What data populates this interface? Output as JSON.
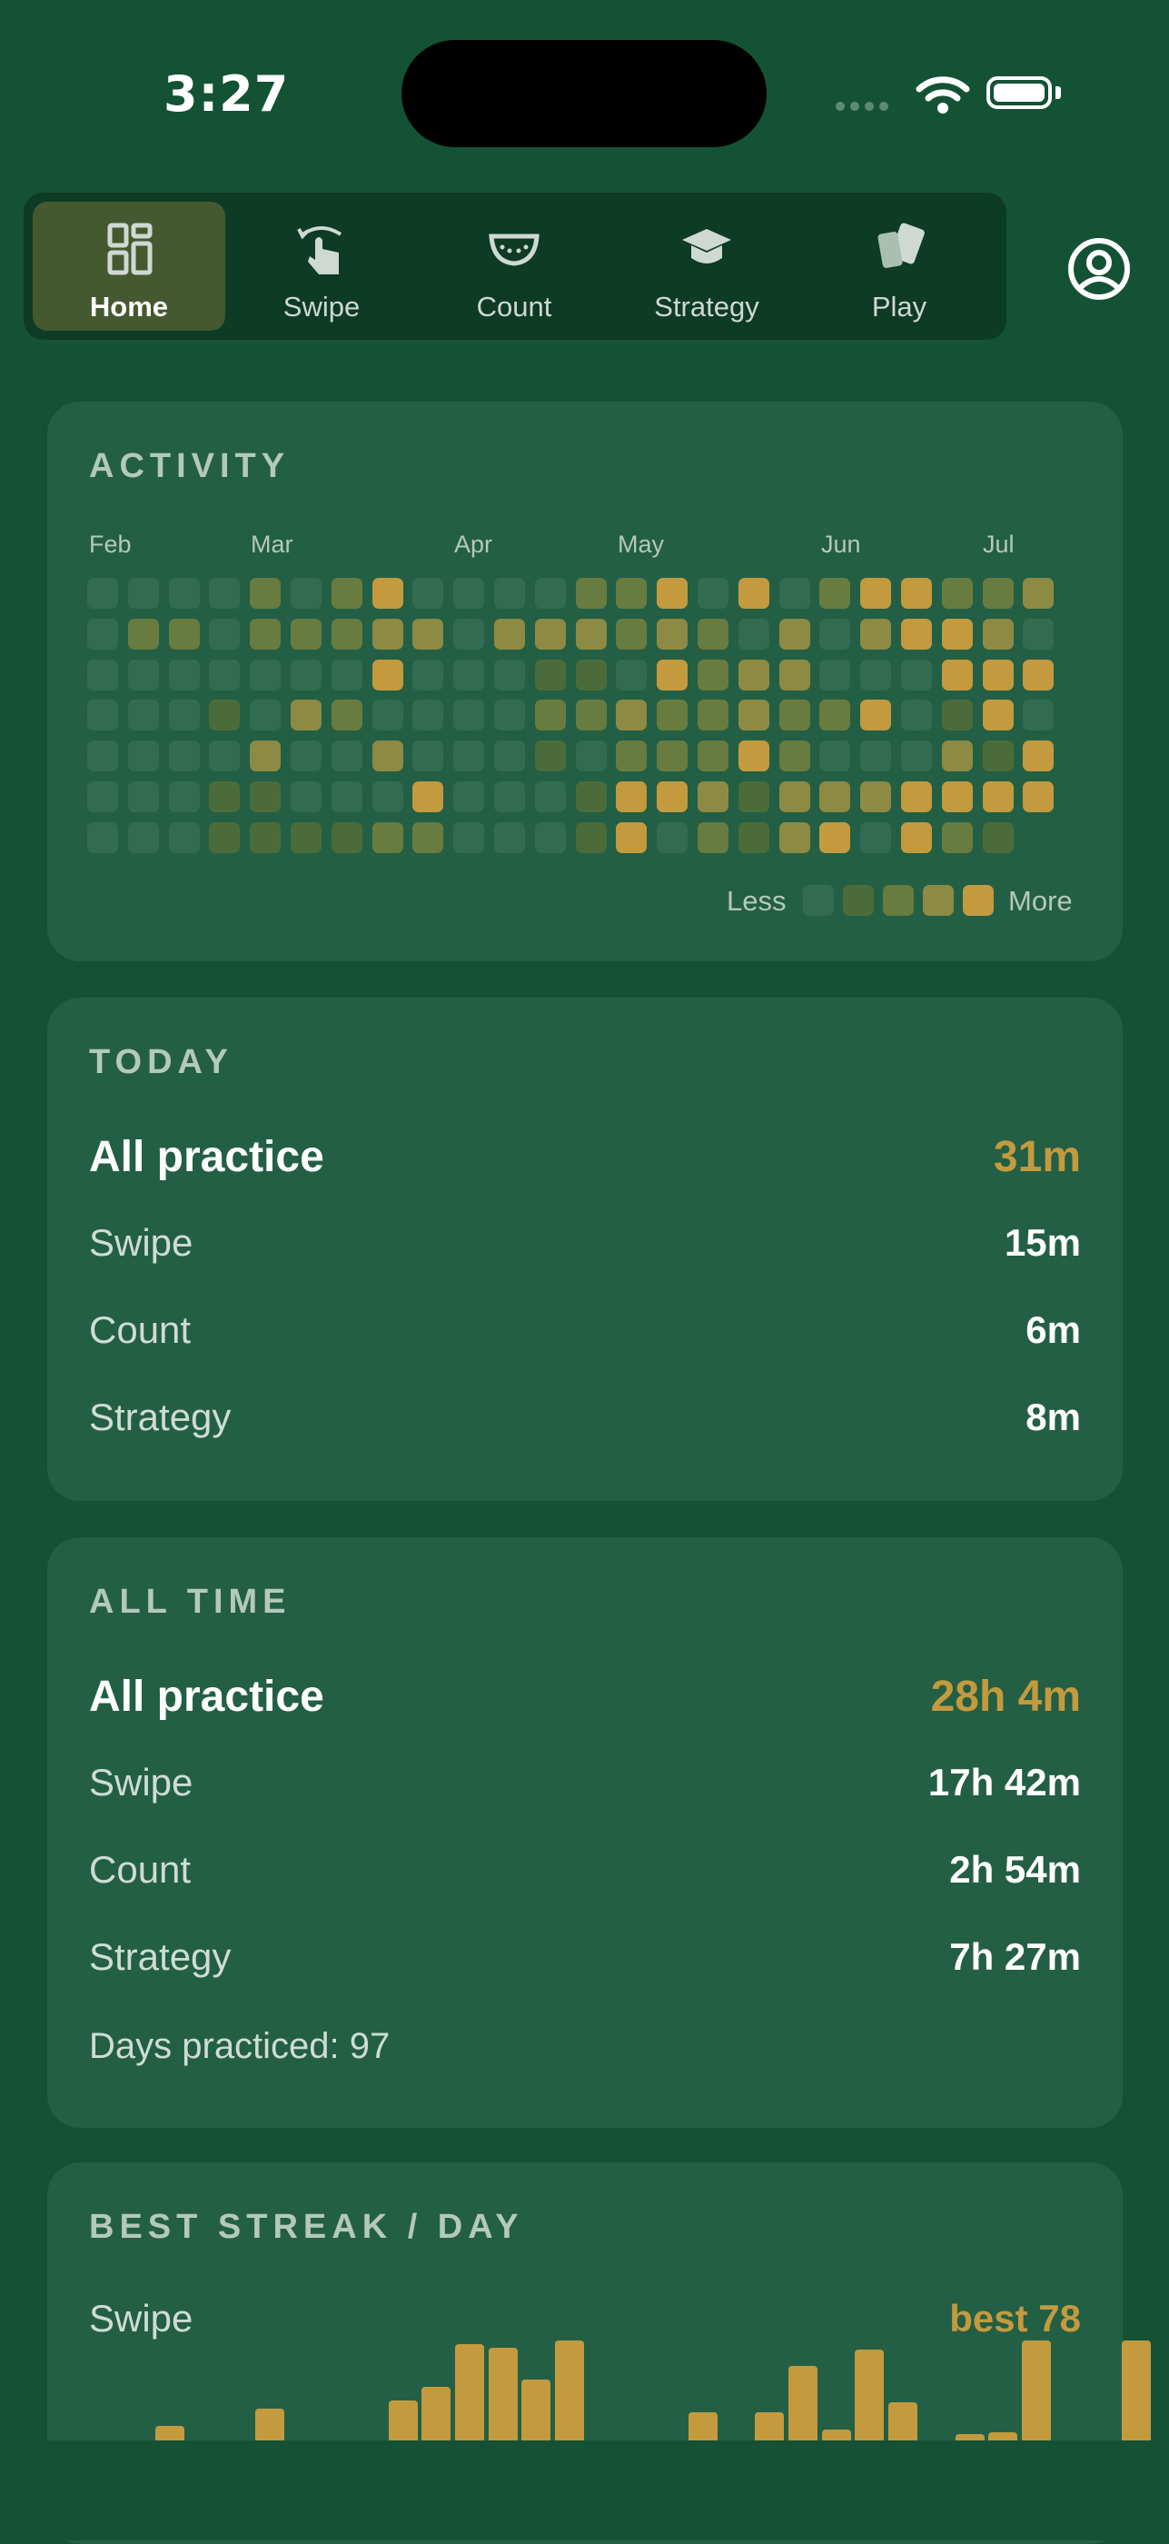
{
  "status_bar": {
    "time": "3:27"
  },
  "tabs": [
    {
      "label": "Home",
      "icon": "dashboard-icon",
      "active": true
    },
    {
      "label": "Swipe",
      "icon": "swipe-hand-icon",
      "active": false
    },
    {
      "label": "Count",
      "icon": "card-tray-icon",
      "active": false
    },
    {
      "label": "Strategy",
      "icon": "graduation-cap-icon",
      "active": false
    },
    {
      "label": "Play",
      "icon": "cards-icon",
      "active": false
    }
  ],
  "activity": {
    "title": "ACTIVITY",
    "months": [
      "Feb",
      "Mar",
      "Apr",
      "May",
      "Jun",
      "Jul"
    ],
    "legend_less": "Less",
    "legend_more": "More",
    "level_colors": [
      "#326b51",
      "#4b6c3a",
      "#687c3f",
      "#8d8a43",
      "#c39a3e"
    ],
    "grid_levels": [
      [
        0,
        0,
        0,
        0,
        2,
        0,
        2,
        4,
        0,
        0,
        0,
        0,
        2,
        2,
        4,
        0,
        4,
        0,
        2,
        4,
        4,
        2,
        2,
        3
      ],
      [
        0,
        2,
        2,
        0,
        2,
        2,
        2,
        3,
        3,
        0,
        3,
        3,
        3,
        2,
        3,
        2,
        0,
        3,
        0,
        3,
        4,
        4,
        3,
        0
      ],
      [
        0,
        0,
        0,
        0,
        0,
        0,
        0,
        4,
        0,
        0,
        0,
        1,
        1,
        0,
        4,
        2,
        3,
        3,
        0,
        0,
        0,
        4,
        4,
        4
      ],
      [
        0,
        0,
        0,
        1,
        0,
        3,
        2,
        0,
        0,
        0,
        0,
        2,
        2,
        3,
        2,
        2,
        3,
        2,
        2,
        4,
        0,
        1,
        4,
        0
      ],
      [
        0,
        0,
        0,
        0,
        3,
        0,
        0,
        3,
        0,
        0,
        0,
        1,
        0,
        2,
        2,
        2,
        4,
        2,
        0,
        0,
        0,
        3,
        1,
        4
      ],
      [
        0,
        0,
        0,
        1,
        1,
        0,
        0,
        0,
        4,
        0,
        0,
        0,
        1,
        4,
        4,
        3,
        1,
        3,
        3,
        3,
        4,
        4,
        4,
        4
      ],
      [
        0,
        0,
        0,
        1,
        1,
        1,
        1,
        2,
        2,
        0,
        0,
        0,
        1,
        4,
        0,
        2,
        1,
        3,
        4,
        0,
        4,
        2,
        1,
        -1
      ]
    ]
  },
  "today": {
    "title": "TODAY",
    "rows": [
      {
        "label": "All practice",
        "value": "31m"
      },
      {
        "label": "Swipe",
        "value": "15m"
      },
      {
        "label": "Count",
        "value": "6m"
      },
      {
        "label": "Strategy",
        "value": "8m"
      }
    ]
  },
  "all_time": {
    "title": "ALL TIME",
    "rows": [
      {
        "label": "All practice",
        "value": "28h 4m"
      },
      {
        "label": "Swipe",
        "value": "17h 42m"
      },
      {
        "label": "Count",
        "value": "2h 54m"
      },
      {
        "label": "Strategy",
        "value": "7h 27m"
      }
    ],
    "days_practiced": "Days practiced: 97"
  },
  "best_streak": {
    "title": "BEST STREAK / DAY",
    "subtitle": "Swipe",
    "best": "best 78",
    "chart_data": {
      "type": "bar",
      "max": 78,
      "values": [
        0,
        30,
        0,
        8,
        40,
        0,
        0,
        20,
        45,
        53,
        78,
        76,
        57,
        80,
        0,
        0,
        0,
        38,
        0,
        38,
        65,
        28,
        75,
        44,
        10,
        25,
        26,
        80,
        8,
        0,
        80,
        20
      ]
    }
  }
}
